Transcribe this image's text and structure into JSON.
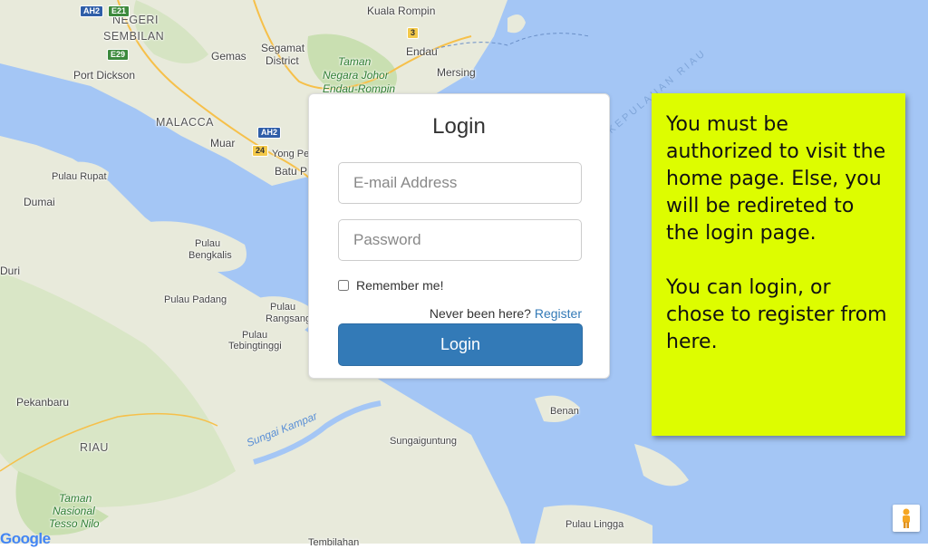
{
  "map": {
    "labels": {
      "kuala_rompin": "Kuala Rompin",
      "negeri": "NEGERI",
      "sembilan": "SEMBILAN",
      "gemas": "Gemas",
      "segamat": "Segamat",
      "district": "District",
      "endau": "Endau",
      "mersing": "Mersing",
      "taman": "Taman",
      "negara_johor": "Negara Johor",
      "endau_rompin": "Endau-Rompin",
      "port_dickson": "Port Dickson",
      "malacca": "MALACCA",
      "muar": "Muar",
      "yong_peng": "Yong Pe",
      "batu_pahat": "Batu P",
      "pulau_rupat_1": "Pulau Rupat",
      "dumai": "Dumai",
      "pulau_bengkalis_1": "Pulau",
      "pulau_bengkalis_2": "Bengkalis",
      "duri": "Duri",
      "pulau_padang": "Pulau Padang",
      "pulau_rangsang_1": "Pulau",
      "pulau_rangsang_2": "Rangsang",
      "pulau_tebingtinggi_1": "Pulau",
      "pulau_tebingtinggi_2": "Tebingtinggi",
      "pekanbaru": "Pekanbaru",
      "riau": "RIAU",
      "sungai_kampar": "Sungai Kampar",
      "sungaiguntung": "Sungaiguntung",
      "benan": "Benan",
      "taman_nasional_1": "Taman",
      "taman_nasional_2": "Nasional",
      "taman_nasional_3": "Tesso Nilo",
      "pulau_lingga": "Pulau Lingga",
      "tembilahan": "Tembilahan",
      "kepulauan_riau": "KEPULAUAN RIAU"
    },
    "shields": {
      "ah2_top": "AH2",
      "e21": "E21",
      "e29": "E29",
      "ah2_mid": "AH2",
      "r24": "24",
      "r3": "3"
    },
    "logo": "Google",
    "colors": {
      "water": "#a4c6f5",
      "land": "#e8eadb",
      "forest": "#c9dfb1"
    }
  },
  "login": {
    "title": "Login",
    "email_placeholder": "E-mail Address",
    "password_placeholder": "Password",
    "remember_label": "Remember me!",
    "register_prompt": "Never been here?",
    "register_link": "Register",
    "login_button": "Login",
    "accent": "#337ab7"
  },
  "note": {
    "paragraph_1": "You must be authorized to visit the home page. Else, you will be redireted to the login page.",
    "paragraph_2": "You can login, or chose to register from here.",
    "background": "#ddfd00"
  }
}
